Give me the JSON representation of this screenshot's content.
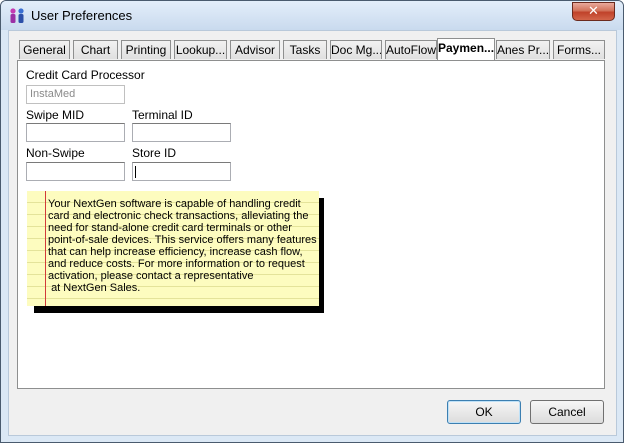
{
  "window": {
    "title": "User Preferences",
    "close_glyph": "✕"
  },
  "tabs": [
    {
      "label": "General",
      "active": false
    },
    {
      "label": "Chart",
      "active": false
    },
    {
      "label": "Printing",
      "active": false
    },
    {
      "label": "Lookup...",
      "active": false
    },
    {
      "label": "Advisor",
      "active": false
    },
    {
      "label": "Tasks",
      "active": false
    },
    {
      "label": "Doc Mg...",
      "active": false
    },
    {
      "label": "AutoFlow",
      "active": false
    },
    {
      "label": "Paymen...",
      "active": true
    },
    {
      "label": "Anes Pr...",
      "active": false
    },
    {
      "label": "Forms...",
      "active": false
    }
  ],
  "payment": {
    "processor_label": "Credit Card Processor",
    "processor_value": "InstaMed",
    "swipe_mid_label": "Swipe MID",
    "swipe_mid_value": "",
    "terminal_id_label": "Terminal ID",
    "terminal_id_value": "",
    "non_swipe_label": "Non-Swipe",
    "non_swipe_value": "",
    "store_id_label": "Store ID",
    "store_id_value": ""
  },
  "note": {
    "text": "Your NextGen software is capable of handling credit\ncard and electronic check transactions, alleviating the\nneed for stand-alone credit card terminals or other\npoint-of-sale devices. This service offers many features\nthat can help increase efficiency, increase cash flow,\nand reduce costs. For more information or to request\nactivation, please contact a representative\n at NextGen Sales."
  },
  "buttons": {
    "ok": "OK",
    "cancel": "Cancel"
  },
  "colors": {
    "note_background": "#fdfcbf",
    "note_margin_line": "#d23a3a",
    "close_button": "#c0422a"
  }
}
